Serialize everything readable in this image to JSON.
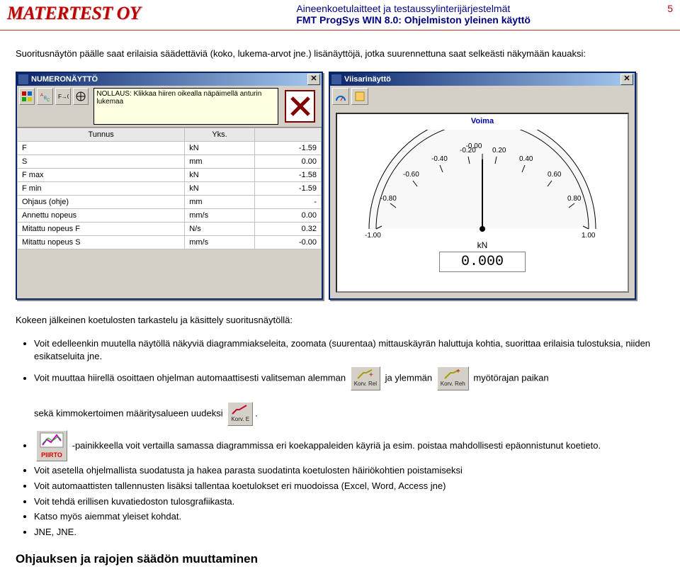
{
  "header": {
    "logo": "MATERTEST OY",
    "line1": "Aineenkoetulaitteet ja testaussylinterijärjestelmät",
    "line2": "FMT ProgSys WIN 8.0: Ohjelmiston yleinen käyttö",
    "page_num": "5"
  },
  "intro_para": "Suoritusnäytön päälle saat erilaisia säädettäviä (koko, lukema-arvot jne.) lisänäyttöjä, jotka suurennettuna saat selkeästi näkymään kauaksi:",
  "win_left": {
    "title": "NUMERONÄYTTÖ",
    "tooltip": "NOLLAUS: Klikkaa hiiren oikealla näpäimellä anturin lukemaa",
    "columns": [
      "Tunnus",
      "Yks.",
      "",
      ""
    ],
    "rows": [
      {
        "t": "F",
        "u": "kN",
        "v": "-1.59"
      },
      {
        "t": "S",
        "u": "mm",
        "v": "0.00"
      },
      {
        "t": "F max",
        "u": "kN",
        "v": "-1.58"
      },
      {
        "t": "F min",
        "u": "kN",
        "v": "-1.59"
      },
      {
        "t": "Ohjaus (ohje)",
        "u": "mm",
        "v": "-"
      },
      {
        "t": "Annettu nopeus",
        "u": "mm/s",
        "v": "0.00"
      },
      {
        "t": "Mitattu nopeus F",
        "u": "N/s",
        "v": "0.32"
      },
      {
        "t": "Mitattu nopeus S",
        "u": "mm/s",
        "v": "-0.00"
      }
    ]
  },
  "win_right": {
    "title": "Viisarinäyttö",
    "gauge_title": "Voima",
    "scale": [
      "-1.00",
      "-0.80",
      "-0.60",
      "-0.40",
      "-0.20",
      "-0.00",
      "0.20",
      "0.40",
      "0.60",
      "0.80",
      "1.00"
    ],
    "unit": "kN",
    "readout": "0.000"
  },
  "post_heading": "Kokeen jälkeinen koetulosten tarkastelu ja käsittely suoritusnäytöllä:",
  "bullets1": [
    "Voit edelleenkin muutella näytöllä näkyviä diagrammiakseleita, zoomata (suurentaa) mittauskäyrän haluttuja kohtia, suorittaa erilaisia tulostuksia, niiden esikatseluita jne."
  ],
  "bullet_line2a": "Voit muuttaa hiirellä osoittaen ohjelman automaattisesti valitseman alemman",
  "bullet_line2b_mid": "ja ylemmän",
  "bullet_line2_end": "myötörajan paikan",
  "bullet_line3a": "sekä kimmokertoimen määritysalueen uudeksi",
  "bullet_line3_end": ".",
  "btn_rel_label": "Korv. Rel",
  "btn_reh_label": "Korv. Reh",
  "btn_e_label": "Korv. E",
  "btn_piirto_word": "PIIRTO",
  "bullets3": [
    "-painikkeella voit vertailla samassa diagrammissa eri koekappaleiden käyriä ja esim. poistaa mahdollisesti epäonnistunut koetieto.",
    "Voit asetella ohjelmallista suodatusta ja hakea parasta suodatinta koetulosten häiriökohtien poistamiseksi",
    "Voit automaattisten tallennusten lisäksi tallentaa koetulokset eri muodoissa (Excel, Word, Access jne)",
    "Voit tehdä erillisen kuvatiedoston tulosgrafiikasta.",
    "Katso myös aiemmat yleiset kohdat.",
    "JNE, JNE."
  ],
  "section_title": "Ohjauksen ja rajojen säädön muuttaminen"
}
